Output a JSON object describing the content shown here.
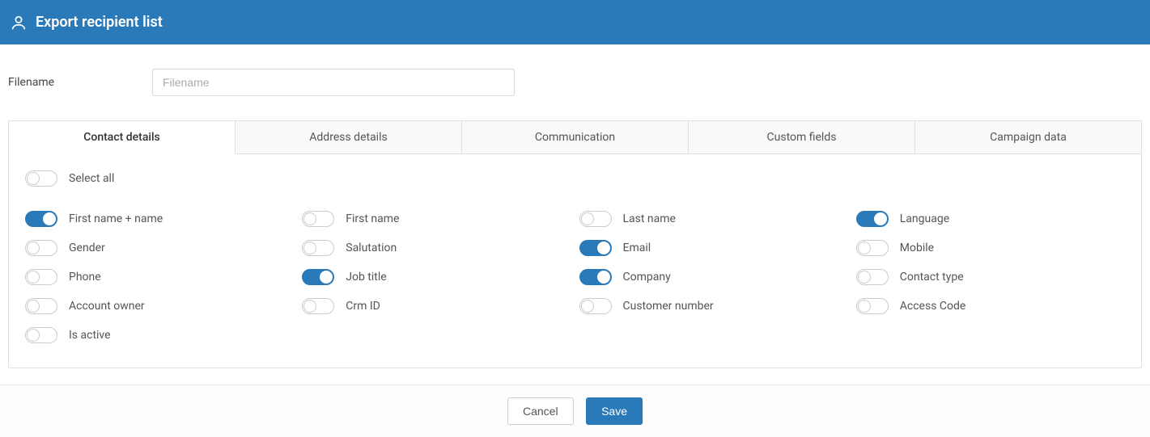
{
  "header": {
    "title": "Export recipient list"
  },
  "filename": {
    "label": "Filename",
    "placeholder": "Filename",
    "value": ""
  },
  "tabs": [
    {
      "id": "contact-details",
      "label": "Contact details",
      "active": true
    },
    {
      "id": "address-details",
      "label": "Address details",
      "active": false
    },
    {
      "id": "communication",
      "label": "Communication",
      "active": false
    },
    {
      "id": "custom-fields",
      "label": "Custom fields",
      "active": false
    },
    {
      "id": "campaign-data",
      "label": "Campaign data",
      "active": false
    }
  ],
  "select_all": {
    "label": "Select all",
    "checked": false
  },
  "fields": [
    {
      "id": "first-name-name",
      "label": "First name + name",
      "checked": true
    },
    {
      "id": "first-name",
      "label": "First name",
      "checked": false
    },
    {
      "id": "last-name",
      "label": "Last name",
      "checked": false
    },
    {
      "id": "language",
      "label": "Language",
      "checked": true
    },
    {
      "id": "gender",
      "label": "Gender",
      "checked": false
    },
    {
      "id": "salutation",
      "label": "Salutation",
      "checked": false
    },
    {
      "id": "email",
      "label": "Email",
      "checked": true
    },
    {
      "id": "mobile",
      "label": "Mobile",
      "checked": false
    },
    {
      "id": "phone",
      "label": "Phone",
      "checked": false
    },
    {
      "id": "job-title",
      "label": "Job title",
      "checked": true
    },
    {
      "id": "company",
      "label": "Company",
      "checked": true
    },
    {
      "id": "contact-type",
      "label": "Contact type",
      "checked": false
    },
    {
      "id": "account-owner",
      "label": "Account owner",
      "checked": false
    },
    {
      "id": "crm-id",
      "label": "Crm ID",
      "checked": false
    },
    {
      "id": "customer-number",
      "label": "Customer number",
      "checked": false
    },
    {
      "id": "access-code",
      "label": "Access Code",
      "checked": false
    },
    {
      "id": "is-active",
      "label": "Is active",
      "checked": false
    }
  ],
  "footer": {
    "cancel": "Cancel",
    "save": "Save"
  }
}
